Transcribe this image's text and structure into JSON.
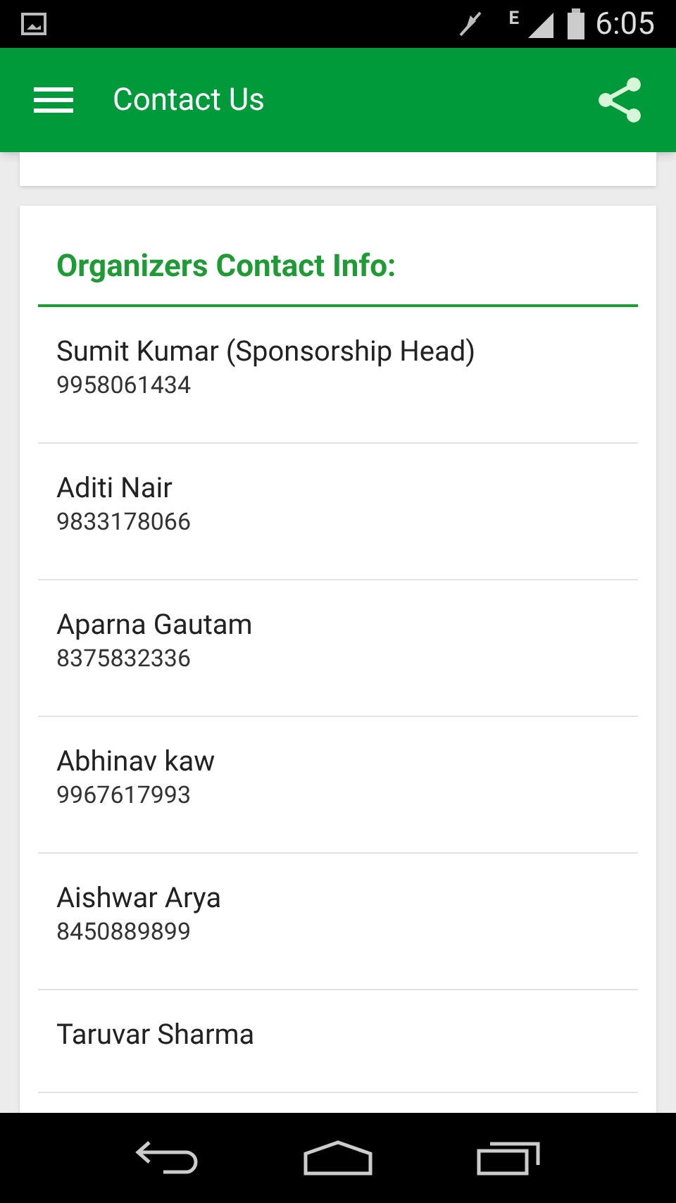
{
  "status_bar": {
    "time": "6:05",
    "network": "E"
  },
  "app_bar": {
    "title": "Contact Us"
  },
  "section": {
    "title": "Organizers Contact Info:"
  },
  "contacts": [
    {
      "name": "Sumit Kumar (Sponsorship Head)",
      "phone": "9958061434"
    },
    {
      "name": "Aditi Nair",
      "phone": "9833178066"
    },
    {
      "name": "Aparna Gautam",
      "phone": "8375832336"
    },
    {
      "name": "Abhinav kaw",
      "phone": "9967617993"
    },
    {
      "name": "Aishwar Arya",
      "phone": "8450889899"
    },
    {
      "name": "Taruvar Sharma"
    }
  ]
}
